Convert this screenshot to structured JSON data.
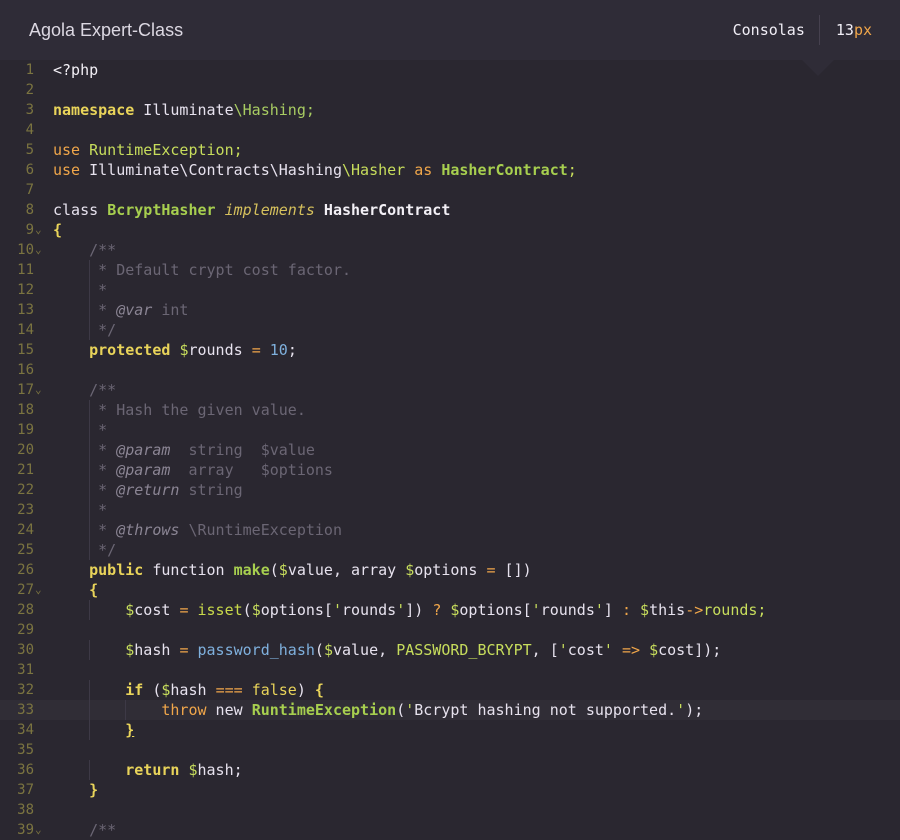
{
  "header": {
    "title": "Agola Expert-Class",
    "font_family": "Consolas",
    "font_size_value": "13",
    "font_size_unit": "px"
  },
  "editor": {
    "active_line": "33",
    "lines": [
      {
        "n": "1",
        "text": "<?php"
      },
      {
        "n": "2",
        "text": ""
      },
      {
        "n": "3",
        "text": "namespace Illuminate\\Hashing;"
      },
      {
        "n": "4",
        "text": ""
      },
      {
        "n": "5",
        "text": "use RuntimeException;"
      },
      {
        "n": "6",
        "text": "use Illuminate\\Contracts\\Hashing\\Hasher as HasherContract;"
      },
      {
        "n": "7",
        "text": ""
      },
      {
        "n": "8",
        "text": "class BcryptHasher implements HasherContract"
      },
      {
        "n": "9",
        "text": "{"
      },
      {
        "n": "10",
        "text": "    /**"
      },
      {
        "n": "11",
        "text": "     * Default crypt cost factor."
      },
      {
        "n": "12",
        "text": "     *"
      },
      {
        "n": "13",
        "text": "     * @var int"
      },
      {
        "n": "14",
        "text": "     */"
      },
      {
        "n": "15",
        "text": "    protected $rounds = 10;"
      },
      {
        "n": "16",
        "text": ""
      },
      {
        "n": "17",
        "text": "    /**"
      },
      {
        "n": "18",
        "text": "     * Hash the given value."
      },
      {
        "n": "19",
        "text": "     *"
      },
      {
        "n": "20",
        "text": "     * @param  string  $value"
      },
      {
        "n": "21",
        "text": "     * @param  array   $options"
      },
      {
        "n": "22",
        "text": "     * @return string"
      },
      {
        "n": "23",
        "text": "     *"
      },
      {
        "n": "24",
        "text": "     * @throws \\RuntimeException"
      },
      {
        "n": "25",
        "text": "     */"
      },
      {
        "n": "26",
        "text": "    public function make($value, array $options = [])"
      },
      {
        "n": "27",
        "text": "    {"
      },
      {
        "n": "28",
        "text": "        $cost = isset($options['rounds']) ? $options['rounds'] : $this->rounds;"
      },
      {
        "n": "29",
        "text": ""
      },
      {
        "n": "30",
        "text": "        $hash = password_hash($value, PASSWORD_BCRYPT, ['cost' => $cost]);"
      },
      {
        "n": "31",
        "text": ""
      },
      {
        "n": "32",
        "text": "        if ($hash === false) {"
      },
      {
        "n": "33",
        "text": "            throw new RuntimeException('Bcrypt hashing not supported.');"
      },
      {
        "n": "34",
        "text": "        }"
      },
      {
        "n": "35",
        "text": ""
      },
      {
        "n": "36",
        "text": "        return $hash;"
      },
      {
        "n": "37",
        "text": "    }"
      },
      {
        "n": "38",
        "text": ""
      },
      {
        "n": "39",
        "text": "    /**"
      }
    ]
  },
  "colors": {
    "background": "#2a2730",
    "header_background": "#2f2c37",
    "keyword_orange": "#f0a64a",
    "keyword_yellow": "#e9d45a",
    "string_green": "#c7dd5c",
    "number_blue": "#7fb0dd",
    "comment_gray": "#6b6674",
    "line_number": "#7b7440"
  }
}
